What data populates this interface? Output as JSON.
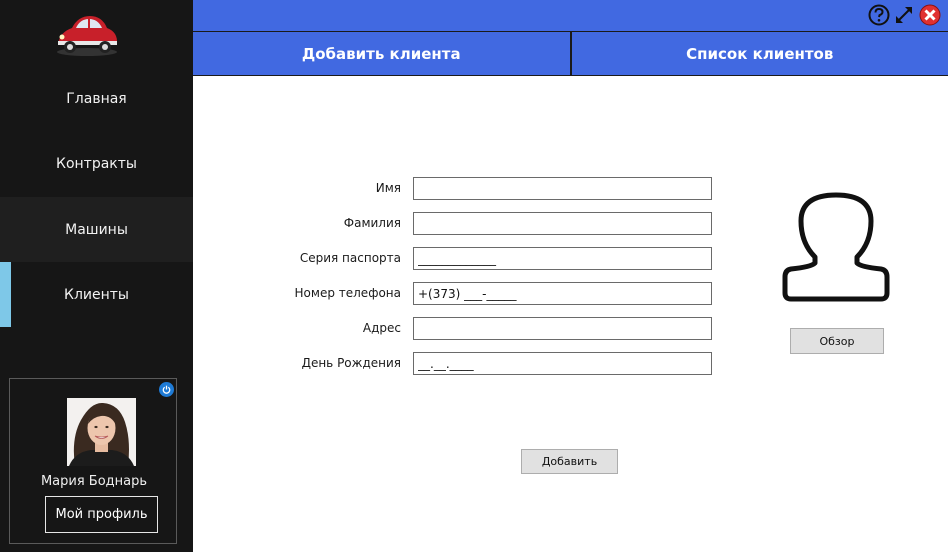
{
  "sidebar": {
    "logo_icon": "red-beetle-car-logo",
    "items": [
      {
        "label": "Главная"
      },
      {
        "label": "Контракты"
      },
      {
        "label": "Машины"
      },
      {
        "label": "Клиенты"
      }
    ],
    "user": {
      "name": "Мария Боднарь",
      "profile_button": "Мой профиль"
    }
  },
  "tabs": [
    {
      "label": "Добавить клиента"
    },
    {
      "label": "Список клиентов"
    }
  ],
  "form": {
    "fields": [
      {
        "label": "Имя",
        "value": ""
      },
      {
        "label": "Фамилия",
        "value": ""
      },
      {
        "label": "Серия паспорта",
        "value": "_____________"
      },
      {
        "label": "Номер телефона",
        "value": "+(373) ___-_____"
      },
      {
        "label": "Адрес",
        "value": ""
      },
      {
        "label": "День Рождения",
        "value": "__.__.____"
      }
    ],
    "browse_button": "Обзор",
    "add_button": "Добавить"
  },
  "colors": {
    "accent": "#4169e1",
    "sidebar_bg": "#161616",
    "active_marker": "#7ec8e8",
    "close": "#e03030"
  }
}
